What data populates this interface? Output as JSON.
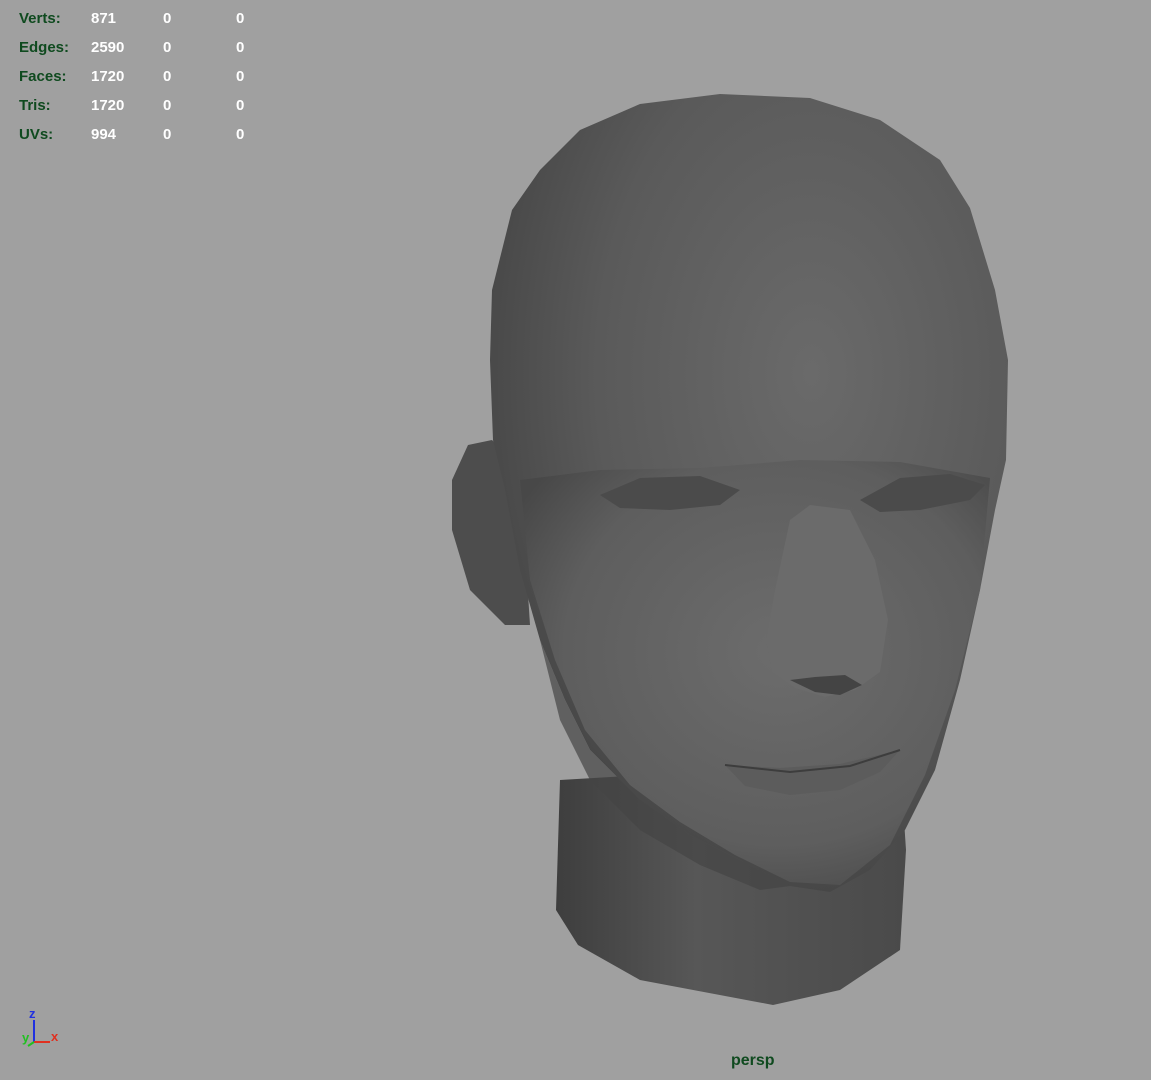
{
  "hud": {
    "rows": [
      {
        "label": "Verts:",
        "total": "871",
        "selected": "0",
        "component": "0"
      },
      {
        "label": "Edges:",
        "total": "2590",
        "selected": "0",
        "component": "0"
      },
      {
        "label": "Faces:",
        "total": "1720",
        "selected": "0",
        "component": "0"
      },
      {
        "label": "Tris:",
        "total": "1720",
        "selected": "0",
        "component": "0"
      },
      {
        "label": "UVs:",
        "total": "994",
        "selected": "0",
        "component": "0"
      }
    ]
  },
  "viewport": {
    "camera": "persp",
    "background_color": "#a0a0a0",
    "model": "head-mesh"
  },
  "axis_gizmo": {
    "z": "z",
    "y": "y",
    "x": "x",
    "colors": {
      "x": "#e03020",
      "y": "#20c020",
      "z": "#2030e0"
    }
  }
}
